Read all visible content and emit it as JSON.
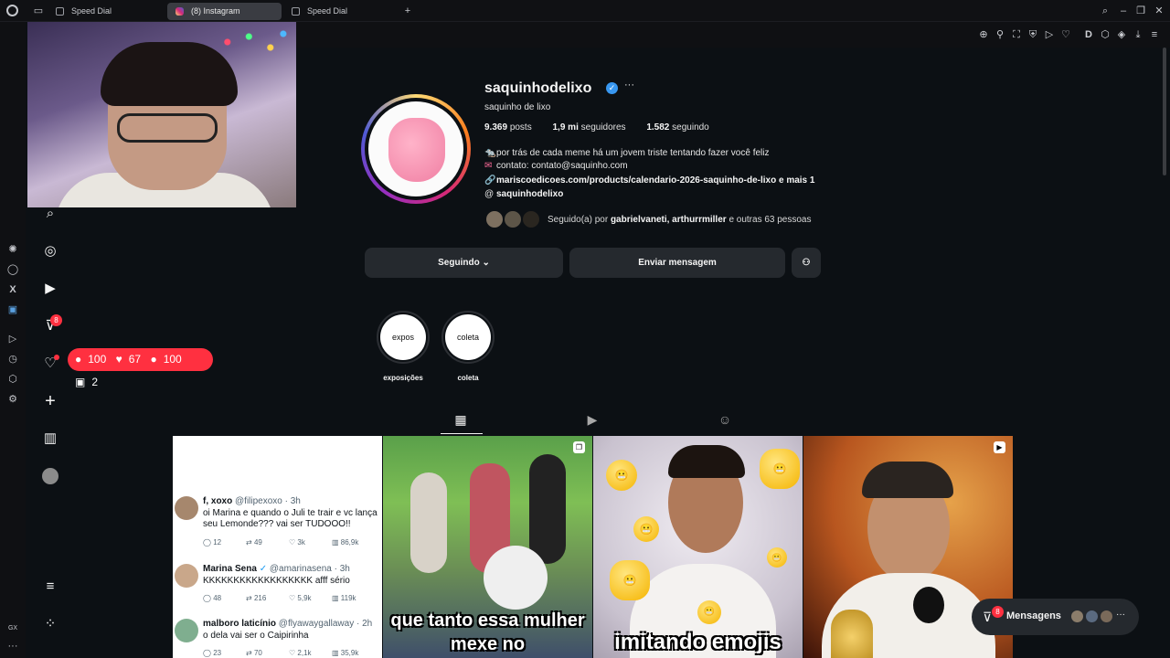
{
  "browser": {
    "tabs": [
      {
        "label": "Speed Dial",
        "active": false
      },
      {
        "label": "(8) Instagram",
        "active": true
      },
      {
        "label": "Speed Dial",
        "active": false
      }
    ],
    "gx_label": "GX"
  },
  "sidebar": {
    "direct_badge": "8",
    "notifications": {
      "comments": "100",
      "likes": "67",
      "follows": "100",
      "requests": "2"
    }
  },
  "profile": {
    "username": "saquinhodelixo",
    "full_name": "saquinho de lixo",
    "stats": {
      "posts_count": "9.369",
      "posts_label": "posts",
      "followers_count": "1,9 mi",
      "followers_label": "seguidores",
      "following_count": "1.582",
      "following_label": "seguindo"
    },
    "bio_line1": "por trás de cada meme há um jovem triste tentando fazer você feliz",
    "bio_line2": "contato: contato@saquinho.com",
    "link": "mariscoedicoes.com/products/calendario-2026-saquinho-de-lixo e mais 1",
    "threads": "saquinhodelixo",
    "mutual_prefix": "Seguido(a) por",
    "mutual_names": "gabrielvaneti, arthurrmiller",
    "mutual_suffix": "e outras 63 pessoas"
  },
  "actions": {
    "following": "Seguindo",
    "message": "Enviar mensagem"
  },
  "highlights": [
    {
      "cover": "expos",
      "label": "exposições"
    },
    {
      "cover": "coleta",
      "label": "coleta"
    }
  ],
  "posts": {
    "tweets": [
      {
        "name": "f, xoxo",
        "handle": "@filipexoxo · 3h",
        "text": "oi Marina e quando o Juli te trair e vc lança seu Lemonde??? vai ser TUDOOO!!",
        "replies": "12",
        "retweets": "49",
        "likes": "3k",
        "views": "86,9k"
      },
      {
        "name": "Marina Sena",
        "handle": "@amarinasena · 3h",
        "text": "KKKKKKKKKKKKKKKKKK afff sério",
        "replies": "48",
        "retweets": "216",
        "likes": "5,9k",
        "views": "119k"
      },
      {
        "name": "malboro laticínio",
        "handle": "@flyawaygallaway · 2h",
        "text": "o dela vai ser o Caipirinha",
        "replies": "23",
        "retweets": "70",
        "likes": "2,1k",
        "views": "35,9k"
      }
    ],
    "caption2": "que tanto essa mulher mexe no",
    "caption3": "imitando emojis"
  },
  "messages": {
    "label": "Mensagens",
    "badge": "8"
  },
  "colors": {
    "background": "#0c1014",
    "button": "#25292e",
    "badge": "#ff3040",
    "verified": "#3897f0"
  }
}
